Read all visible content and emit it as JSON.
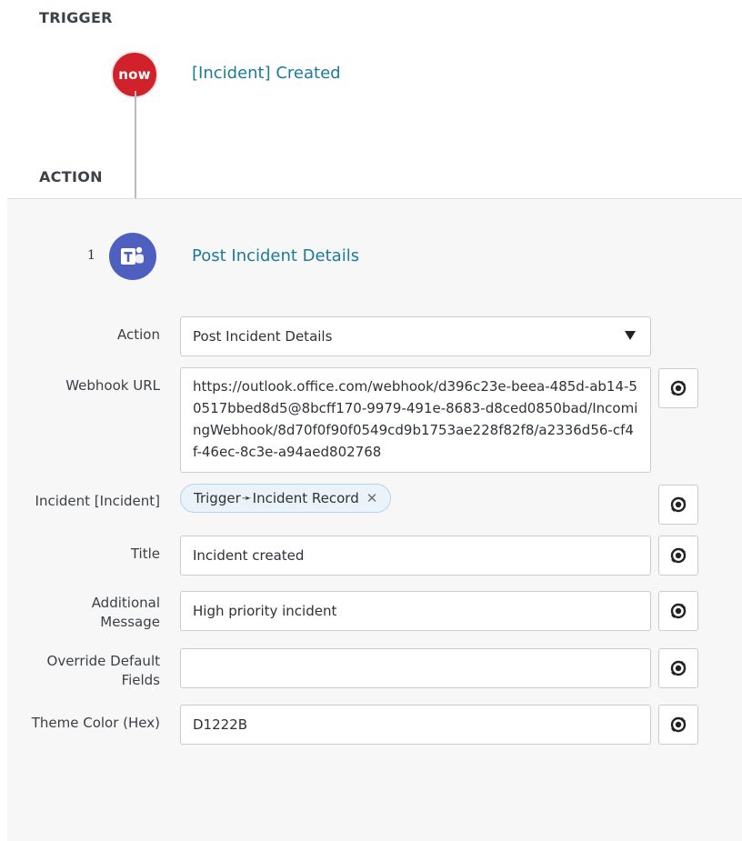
{
  "trigger": {
    "section_label": "TRIGGER",
    "logo_text": "now",
    "title": "[Incident] Created"
  },
  "action": {
    "section_label": "ACTION",
    "step_number": "1",
    "title": "Post Incident Details",
    "icon": "teams-icon"
  },
  "form": {
    "action": {
      "label": "Action",
      "value": "Post Incident Details"
    },
    "webhook_url": {
      "label": "Webhook URL",
      "value": "https://outlook.office.com/webhook/d396c23e-beea-485d-ab14-50517bbed8d5@8bcff170-9979-491e-8683-d8ced0850bad/IncomingWebhook/8d70f0f90f0549cd9b1753ae228f82f8/a2336d56-cf4f-46ec-8c3e-a94aed802768"
    },
    "incident": {
      "label": "Incident [Incident]",
      "pill_trigger": "Trigger",
      "pill_record": "Incident Record",
      "pill_close": "✕"
    },
    "title": {
      "label": "Title",
      "value": "Incident created"
    },
    "additional_message": {
      "label_line1": "Additional",
      "label_line2": "Message",
      "value": "High priority incident"
    },
    "override_default_fields": {
      "label_line1": "Override Default",
      "label_line2": "Fields",
      "value": ""
    },
    "theme_color": {
      "label": "Theme Color (Hex)",
      "value": "D1222B"
    }
  },
  "colors": {
    "servicenow_red": "#d1222b",
    "teams_purple": "#4e5fbf",
    "link_teal": "#1d7a9a"
  }
}
